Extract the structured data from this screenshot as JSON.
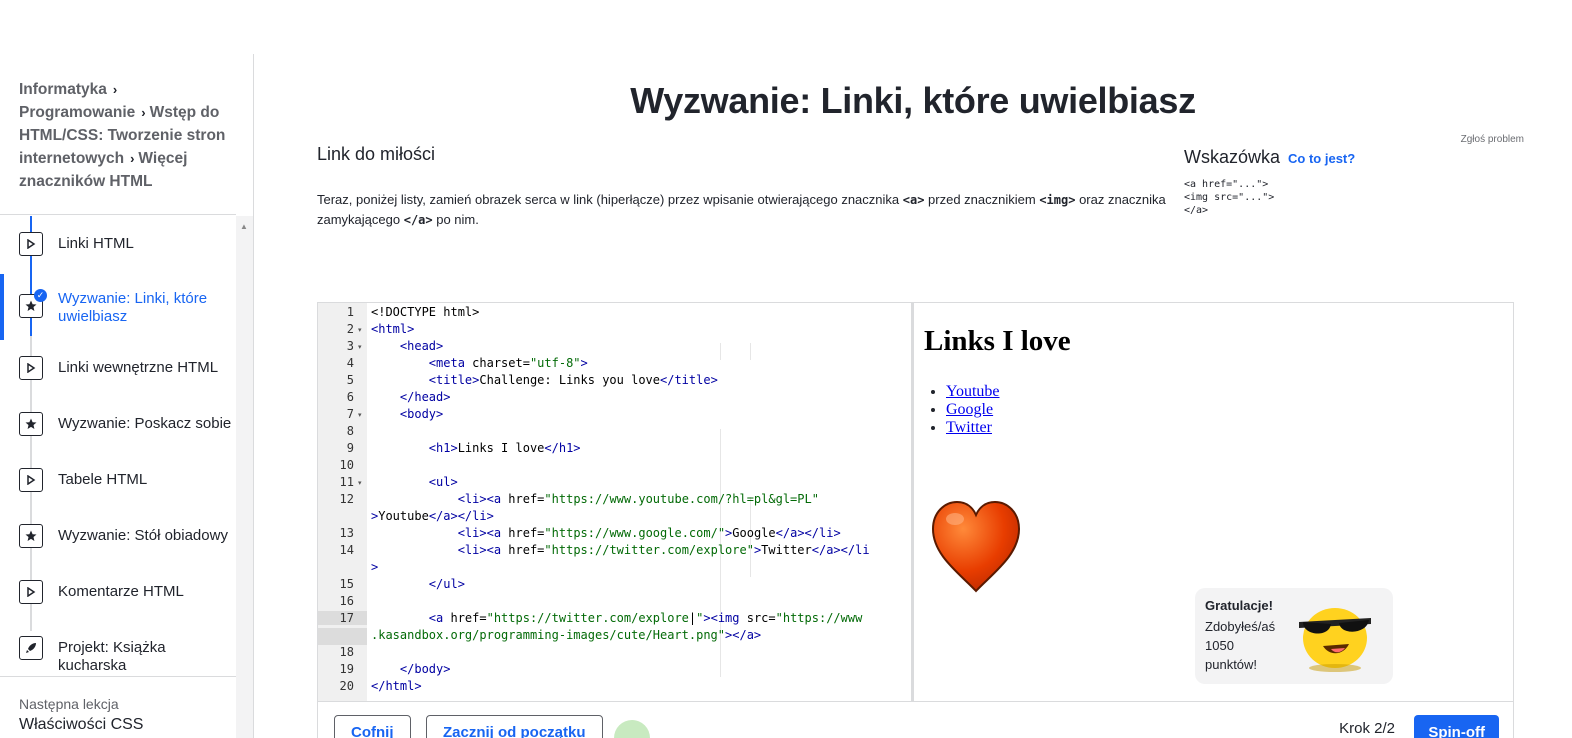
{
  "breadcrumb": {
    "items": [
      "Informatyka",
      "Programowanie",
      "Wstęp do HTML/CSS: Tworzenie stron internetowych",
      "Więcej znaczników HTML"
    ]
  },
  "sidebar": {
    "items": [
      {
        "label": "Linki HTML",
        "type": "video",
        "icon": "play-icon"
      },
      {
        "label": "Wyzwanie: Linki, które uwielbiasz",
        "type": "challenge",
        "icon": "star-icon",
        "active": true,
        "completed": true
      },
      {
        "label": "Linki wewnętrzne HTML",
        "type": "video",
        "icon": "play-icon"
      },
      {
        "label": "Wyzwanie: Poskacz sobie",
        "type": "challenge",
        "icon": "star-icon"
      },
      {
        "label": "Tabele HTML",
        "type": "video",
        "icon": "play-icon"
      },
      {
        "label": "Wyzwanie: Stół obiadowy",
        "type": "challenge",
        "icon": "star-icon"
      },
      {
        "label": "Komentarze HTML",
        "type": "video",
        "icon": "play-icon"
      },
      {
        "label": "Projekt: Książka kucharska",
        "type": "project",
        "icon": "rocket-icon"
      }
    ],
    "next_lesson_label": "Następna lekcja",
    "next_lesson": "Właściwości CSS"
  },
  "page": {
    "title": "Wyzwanie: Linki, które uwielbiasz",
    "report": "Zgłoś problem"
  },
  "challenge": {
    "title": "Link do miłości",
    "instructions_parts": [
      "Teraz, poniżej listy, zamień obrazek serca w link (hiperłącze) przez wpisanie otwierającego znacznika ",
      "<a>",
      " przed znacznikiem ",
      "<img>",
      " oraz znacznika zamykającego ",
      "</a>",
      " po nim."
    ]
  },
  "hint": {
    "title": "Wskazówka",
    "link": "Co to jest?",
    "code": "<a href=\"...\">\n<img src=\"...\">\n</a>"
  },
  "editor": {
    "line_numbers": [
      "1",
      "2",
      "3",
      "4",
      "5",
      "6",
      "7",
      "8",
      "9",
      "10",
      "11",
      "12",
      "",
      "13",
      "14",
      "",
      "15",
      "16",
      "17",
      "",
      "18",
      "19",
      "20"
    ],
    "current_line": "17"
  },
  "preview": {
    "heading": "Links I love",
    "links": [
      "Youtube",
      "Google",
      "Twitter"
    ]
  },
  "toast": {
    "title": "Gratulacje!",
    "message": "Zdobyłeś/aś 1050 punktów!"
  },
  "footer": {
    "back": "Cofnij",
    "restart": "Zacznij od początku",
    "step": "Krok 2/2",
    "spinoff": "Spin-off"
  },
  "colors": {
    "accent": "#1865f2",
    "tag": "#0000a2",
    "string": "#036a07"
  }
}
